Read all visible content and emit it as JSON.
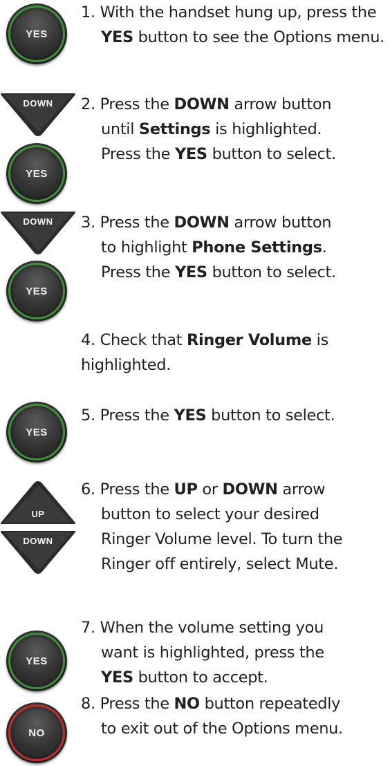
{
  "colors": {
    "yes_ring": "#3f8f3a",
    "no_ring": "#c0302a",
    "button_body": "#2e2e2e",
    "text": "#231f20"
  },
  "buttons": {
    "yes": "YES",
    "no": "NO",
    "up": "UP",
    "down": "DOWN"
  },
  "steps": [
    {
      "num": "1.",
      "parts": [
        "With the handset hung up, press the ",
        "YES",
        " button to see the Options menu."
      ]
    },
    {
      "num": "2.",
      "parts": [
        "Press the ",
        "DOWN",
        " arrow button until ",
        "Settings",
        " is highlighted. Press the ",
        "YES",
        " button to select."
      ]
    },
    {
      "num": "3.",
      "parts": [
        "Press the ",
        "DOWN",
        " arrow button to highlight ",
        "Phone Settings",
        ". Press the ",
        "YES",
        " button to select."
      ]
    },
    {
      "num": "4.",
      "parts": [
        "Check that ",
        "Ringer Volume",
        " is highlighted."
      ]
    },
    {
      "num": "5.",
      "parts": [
        "Press the ",
        "YES",
        " button to select."
      ]
    },
    {
      "num": "6.",
      "parts": [
        "Press the ",
        "UP",
        " or ",
        "DOWN",
        " arrow button to select your desired Ringer Volume level. To turn the Ringer off entirely, select Mute."
      ]
    },
    {
      "num": "7.",
      "parts": [
        "When the volume setting you want is highlighted, press the ",
        "YES",
        " button to accept."
      ]
    },
    {
      "num": "8.",
      "parts": [
        "Press the ",
        "NO",
        " button repeatedly to exit out of the Options menu."
      ]
    }
  ]
}
